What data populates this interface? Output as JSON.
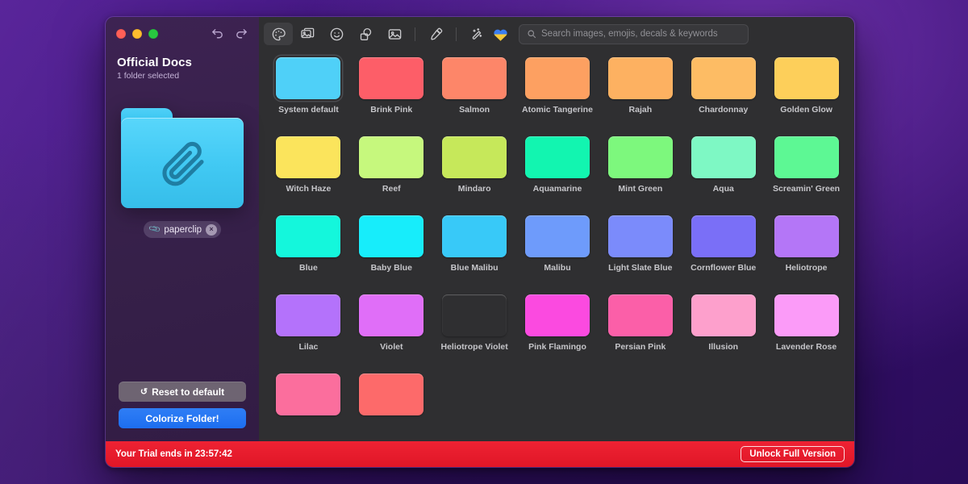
{
  "window": {
    "traffic_lights": [
      "close",
      "minimize",
      "maximize"
    ],
    "undo_label": "Undo",
    "redo_label": "Redo"
  },
  "sidebar": {
    "folder_title": "Official Docs",
    "folder_subtitle": "1 folder selected",
    "folder_color": "#41c9f3",
    "tag": {
      "label": "paperclip",
      "icon": "paperclip-icon",
      "remove": "×"
    },
    "reset_button": {
      "label": "Reset to default",
      "icon": "↺"
    },
    "colorize_button": {
      "label": "Colorize Folder!",
      "color": "#1d6ef0"
    }
  },
  "toolbar": {
    "tools": [
      {
        "name": "palette-icon",
        "active": true
      },
      {
        "name": "images-icon",
        "active": false
      },
      {
        "name": "emoji-icon",
        "active": false
      },
      {
        "name": "shapes-icon",
        "active": false
      },
      {
        "name": "picture-icon",
        "active": false
      },
      {
        "name": "eyedropper-icon",
        "active": false
      },
      {
        "name": "magic-wand-icon",
        "active": false
      }
    ],
    "flag_heart": "ukraine-heart-icon"
  },
  "search": {
    "placeholder": "Search images, emojis, decals & keywords",
    "value": "",
    "icon": "search-icon"
  },
  "palette": {
    "swatches": [
      {
        "label": "System default",
        "color": "#4fd0f8",
        "selected": true
      },
      {
        "label": "Brink Pink",
        "color": "#fd5e68",
        "selected": false
      },
      {
        "label": "Salmon",
        "color": "#fd8669",
        "selected": false
      },
      {
        "label": "Atomic Tangerine",
        "color": "#fda061",
        "selected": false
      },
      {
        "label": "Rajah",
        "color": "#fdb161",
        "selected": false
      },
      {
        "label": "Chardonnay",
        "color": "#fdbc64",
        "selected": false
      },
      {
        "label": "Golden Glow",
        "color": "#fdcf5a",
        "selected": false
      },
      {
        "label": "Witch Haze",
        "color": "#fbe45c",
        "selected": false
      },
      {
        "label": "Reef",
        "color": "#c6f87d",
        "selected": false
      },
      {
        "label": "Mindaro",
        "color": "#c6e85a",
        "selected": false
      },
      {
        "label": "Aquamarine",
        "color": "#12f5b0",
        "selected": false
      },
      {
        "label": "Mint Green",
        "color": "#7df87d",
        "selected": false
      },
      {
        "label": "Aqua",
        "color": "#7ef8c4",
        "selected": false
      },
      {
        "label": "Screamin' Green",
        "color": "#5df894",
        "selected": false
      },
      {
        "label": "Blue",
        "color": "#14f7dc",
        "selected": false
      },
      {
        "label": "Baby Blue",
        "color": "#17edfb",
        "selected": false
      },
      {
        "label": "Blue Malibu",
        "color": "#38c9f8",
        "selected": false
      },
      {
        "label": "Malibu",
        "color": "#6e9bfb",
        "selected": false
      },
      {
        "label": "Light Slate Blue",
        "color": "#7b8bfb",
        "selected": false
      },
      {
        "label": "Cornflower Blue",
        "color": "#7a6ff7",
        "selected": false
      },
      {
        "label": "Heliotrope",
        "color": "#b476f7",
        "selected": false
      },
      {
        "label": "Lilac",
        "color": "#b472fb",
        "selected": false
      },
      {
        "label": "Violet",
        "color": "#e06ef8",
        "selected": false
      },
      {
        "label": "Heliotrope Violet",
        "color": "#f martin",
        "selected": false
      },
      {
        "label": "Pink Flamingo",
        "color": "#fb4ae0",
        "selected": false
      },
      {
        "label": "Persian Pink",
        "color": "#fb5fa8",
        "selected": false
      },
      {
        "label": "Illusion",
        "color": "#fda0cc",
        "selected": false
      },
      {
        "label": "Lavender Rose",
        "color": "#fb9bf8",
        "selected": false
      },
      {
        "label": "",
        "color": "#fb6e9d",
        "selected": false
      },
      {
        "label": "",
        "color": "#fd6a6a",
        "selected": false
      }
    ]
  },
  "trial": {
    "message": "Your Trial ends in 23:57:42",
    "button_label": "Unlock Full Version",
    "bar_color": "#e01627"
  }
}
